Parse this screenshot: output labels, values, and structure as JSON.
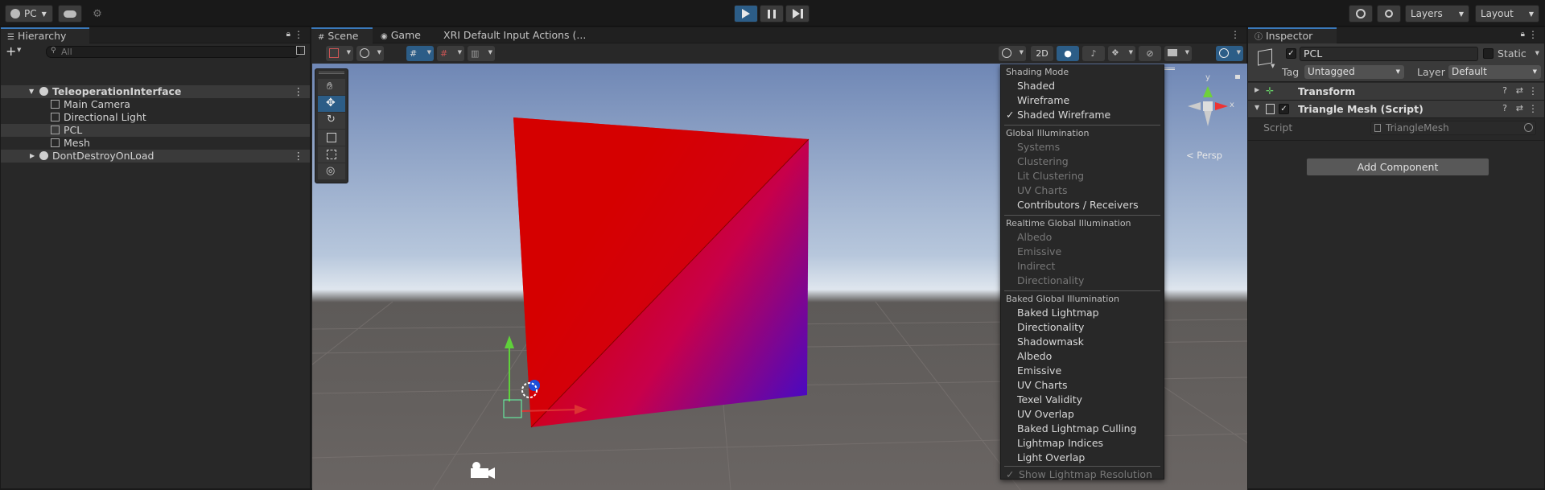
{
  "topbar": {
    "account_label": "PC",
    "layers_label": "Layers",
    "layout_label": "Layout"
  },
  "hierarchy": {
    "tab_label": "Hierarchy",
    "search_placeholder": "All",
    "items": [
      {
        "label": "TeleoperationInterface"
      },
      {
        "label": "Main Camera"
      },
      {
        "label": "Directional Light"
      },
      {
        "label": "PCL"
      },
      {
        "label": "Mesh"
      },
      {
        "label": "DontDestroyOnLoad"
      }
    ]
  },
  "center_tabs": {
    "scene": "Scene",
    "game": "Game",
    "xri": "XRI Default Input Actions (..."
  },
  "scene_toolbar": {
    "mode_2d": "2D"
  },
  "gizmo": {
    "y_label": "y",
    "x_label": "x",
    "persp_label": "< Persp"
  },
  "shading_menu": {
    "header_shading": "Shading Mode",
    "shaded": "Shaded",
    "wireframe": "Wireframe",
    "shaded_wireframe": "Shaded Wireframe",
    "checkmark": "✓",
    "header_gi": "Global Illumination",
    "gi_items": [
      "Systems",
      "Clustering",
      "Lit Clustering",
      "UV Charts",
      "Contributors / Receivers"
    ],
    "header_realtime": "Realtime Global Illumination",
    "realtime_items": [
      "Albedo",
      "Emissive",
      "Indirect",
      "Directionality"
    ],
    "header_baked": "Baked Global Illumination",
    "baked_items": [
      "Baked Lightmap",
      "Directionality",
      "Shadowmask",
      "Albedo",
      "Emissive",
      "UV Charts",
      "Texel Validity",
      "UV Overlap",
      "Baked Lightmap Culling",
      "Lightmap Indices",
      "Light Overlap"
    ],
    "show_lightmap_resolution": "Show Lightmap Resolution"
  },
  "inspector": {
    "tab_label": "Inspector",
    "object_name": "PCL",
    "static_label": "Static",
    "tag_label": "Tag",
    "tag_value": "Untagged",
    "layer_label": "Layer",
    "layer_value": "Default",
    "transform_label": "Transform",
    "component_label": "Triangle Mesh (Script)",
    "script_label": "Script",
    "script_value": "TriangleMesh",
    "add_component": "Add Component"
  },
  "colors": {
    "accent": "#3a79bb",
    "play_active": "#2c5d87",
    "panel_bg": "#282828"
  }
}
